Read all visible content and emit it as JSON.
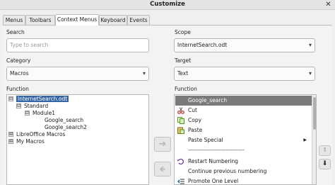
{
  "window": {
    "title": "Customize"
  },
  "tabs": [
    {
      "label": "Menus",
      "active": false
    },
    {
      "label": "Toolbars",
      "active": false
    },
    {
      "label": "Context Menus",
      "active": true
    },
    {
      "label": "Keyboard",
      "active": false
    },
    {
      "label": "Events",
      "active": false
    }
  ],
  "search": {
    "label": "Search",
    "placeholder": "Type to search"
  },
  "category": {
    "label": "Category",
    "value": "Macros"
  },
  "function_left": {
    "label": "Function",
    "tree": [
      {
        "label": "InternetSearch.odt",
        "expander": "⊟",
        "selected": true
      },
      {
        "label": "Standard",
        "expander": "⊟",
        "selected": false
      },
      {
        "label": "Module1",
        "expander": "⊟",
        "selected": false
      },
      {
        "label": "Google_search",
        "expander": "",
        "selected": false
      },
      {
        "label": "Google_search2",
        "expander": "",
        "selected": false
      },
      {
        "label": "LibreOffice Macros",
        "expander": "⊞",
        "selected": false
      },
      {
        "label": "My Macros",
        "expander": "⊞",
        "selected": false
      }
    ]
  },
  "scope": {
    "label": "Scope",
    "value": "InternetSearch.odt"
  },
  "target": {
    "label": "Target",
    "value": "Text"
  },
  "function_right": {
    "label": "Function",
    "items": [
      {
        "label": "Google_search",
        "icon": "",
        "selected": true,
        "submenu": false
      },
      {
        "label": "Cut",
        "icon": "scissors-icon",
        "selected": false,
        "submenu": false
      },
      {
        "label": "Copy",
        "icon": "copy-icon",
        "selected": false,
        "submenu": false
      },
      {
        "label": "Paste",
        "icon": "paste-icon",
        "selected": false,
        "submenu": false
      },
      {
        "label": "Paste Special",
        "icon": "",
        "selected": false,
        "submenu": true
      },
      {
        "label": "------------------------------------",
        "icon": "",
        "selected": false,
        "submenu": false
      },
      {
        "label": "Restart Numbering",
        "icon": "restart-numbering-icon",
        "selected": false,
        "submenu": false
      },
      {
        "label": "Continue previous numbering",
        "icon": "",
        "selected": false,
        "submenu": false
      },
      {
        "label": "Promote One Level",
        "icon": "promote-level-icon",
        "selected": false,
        "submenu": false
      }
    ]
  },
  "buttons": {
    "add_arrow": "➜",
    "remove_arrow": "🡸",
    "move_up": "⬆",
    "move_down": "⬇"
  },
  "submenu_glyph": "▶",
  "select_arrow": "▾",
  "close_glyph": "✕"
}
